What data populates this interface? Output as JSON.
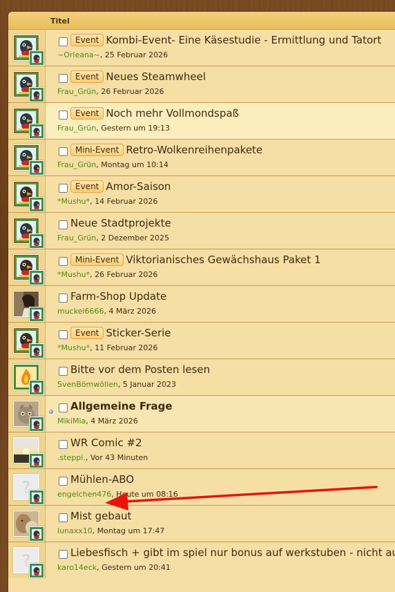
{
  "header": {
    "title_col": "Titel"
  },
  "colors": {
    "author": "#4f8a12",
    "badge_bg": "#ffcc73",
    "arrow": "#e8140c"
  },
  "topics": [
    {
      "prefix": "Event",
      "title": "Kombi-Event- Eine Käsestudie - Ermittlung und Tatort",
      "author": "~Orleana~",
      "date": ", 25 Februar 2026",
      "avatar": "parrot",
      "bold": false
    },
    {
      "prefix": "Event",
      "title": "Neues Steamwheel",
      "author": "Frau_Grün",
      "date": ", 26 Februar 2026",
      "avatar": "parrot",
      "bold": false
    },
    {
      "prefix": "Event",
      "title": "Noch mehr Vollmondspaß",
      "author": "Frau_Grün",
      "date": ", Gestern um 19:13",
      "avatar": "parrot",
      "bold": false
    },
    {
      "prefix": "Mini-Event",
      "title": "Retro-Wolkenreihenpakete",
      "author": "Frau_Grün",
      "date": ", Montag um 10:14",
      "avatar": "parrot",
      "bold": false
    },
    {
      "prefix": "Event",
      "title": "Amor-Saison",
      "author": "*Mushu*",
      "date": ", 14 Februar 2026",
      "avatar": "cat",
      "bold": false
    },
    {
      "prefix": "",
      "title": "Neue Stadtprojekte",
      "author": "Frau_Grün",
      "date": ", 2 Dezember 2025",
      "avatar": "parrot",
      "bold": false
    },
    {
      "prefix": "Mini-Event",
      "title": "Viktorianisches Gewächshaus Paket 1",
      "author": "*Mushu*",
      "date": ", 26 Februar 2026",
      "avatar": "cat",
      "bold": false
    },
    {
      "prefix": "",
      "title": "Farm-Shop Update",
      "author": "muckel6666",
      "date": ", 4 März 2026",
      "avatar": "photo-woman",
      "bold": false
    },
    {
      "prefix": "Event",
      "title": "Sticker-Serie",
      "author": "*Mushu*",
      "date": ", 11 Februar 2026",
      "avatar": "cat",
      "bold": false
    },
    {
      "prefix": "",
      "title": "Bitte vor dem Posten lesen",
      "author": "SvenBömwöllen",
      "date": ", 5 Januar 2023",
      "avatar": "flame",
      "bold": false
    },
    {
      "prefix": "",
      "title": "Allgemeine Frage",
      "author": "MikiMia",
      "date": ", 4 März 2026",
      "avatar": "kitten",
      "bold": true
    },
    {
      "prefix": "",
      "title": "WR Comic #2",
      "author": ".steppi.",
      "date": ", Vor 43 Minuten",
      "avatar": "sunset",
      "bold": false
    },
    {
      "prefix": "",
      "title": "Mühlen-ABO",
      "author": "engelchen476",
      "date": ", Heute um 08:16",
      "avatar": "placeholder",
      "bold": false
    },
    {
      "prefix": "",
      "title": "Mist gebaut",
      "author": "lunaxx10",
      "date": ", Montag um 17:47",
      "avatar": "photo-cat",
      "bold": false
    },
    {
      "prefix": "",
      "title": "Liebesfisch + gibt im spiel nur bonus auf werkstuben - nicht auf",
      "author": "karo14eck",
      "date": ", Gestern um 20:41",
      "avatar": "placeholder",
      "bold": false
    }
  ]
}
